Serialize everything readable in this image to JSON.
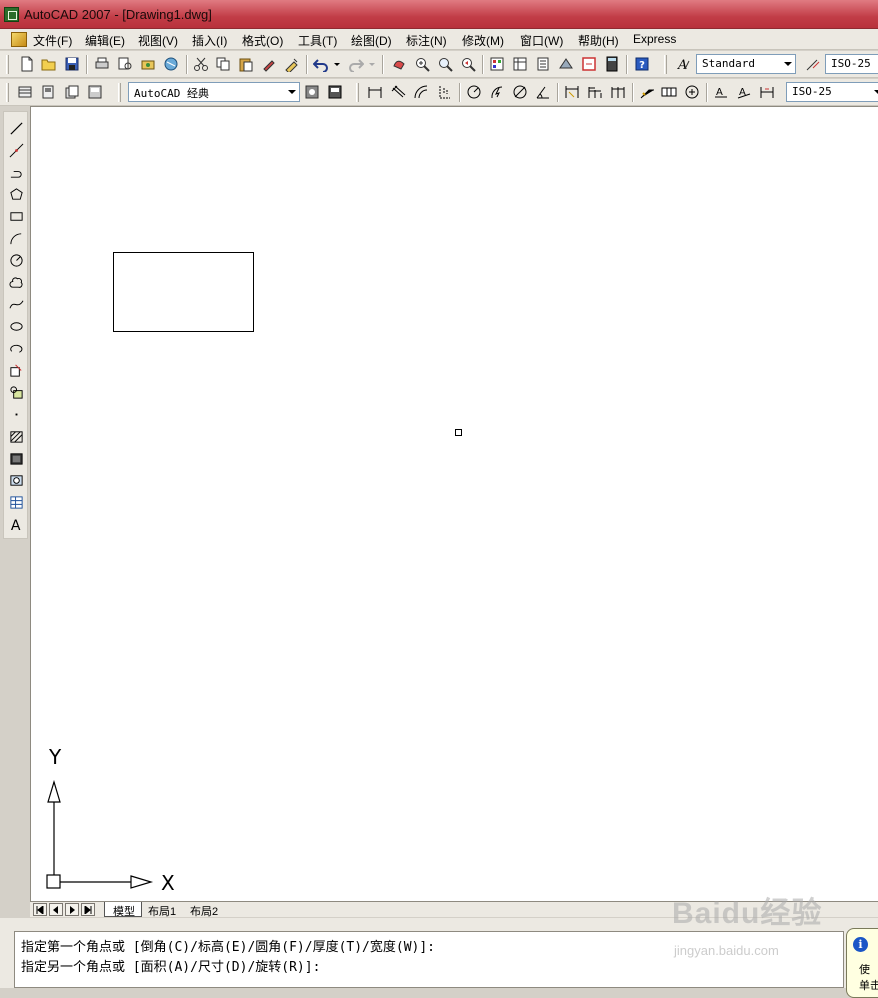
{
  "window": {
    "title": "AutoCAD 2007 - [Drawing1.dwg]"
  },
  "menubar": {
    "items": [
      "文件(F)",
      "编辑(E)",
      "视图(V)",
      "插入(I)",
      "格式(O)",
      "工具(T)",
      "绘图(D)",
      "标注(N)",
      "修改(M)",
      "窗口(W)",
      "帮助(H)",
      "Express"
    ]
  },
  "toolbar": {
    "text_style": "Standard",
    "dim_style": "ISO-25",
    "workspace": "AutoCAD 经典",
    "dim_style_2": "ISO-25"
  },
  "ucs": {
    "x_label": "X",
    "y_label": "Y"
  },
  "layout_tabs": {
    "model": "模型",
    "layout1": "布局1",
    "layout2": "布局2"
  },
  "command": {
    "line1": "指定第一个角点或 [倒角(C)/标高(E)/圆角(F)/厚度(T)/宽度(W)]:",
    "line2": "指定另一个角点或 [面积(A)/尺寸(D)/旋转(R)]:"
  },
  "watermark": {
    "main": "Baidu经验",
    "sub": "jingyan.baidu.com"
  },
  "balloon": {
    "line1": "使",
    "line2": "单击"
  }
}
